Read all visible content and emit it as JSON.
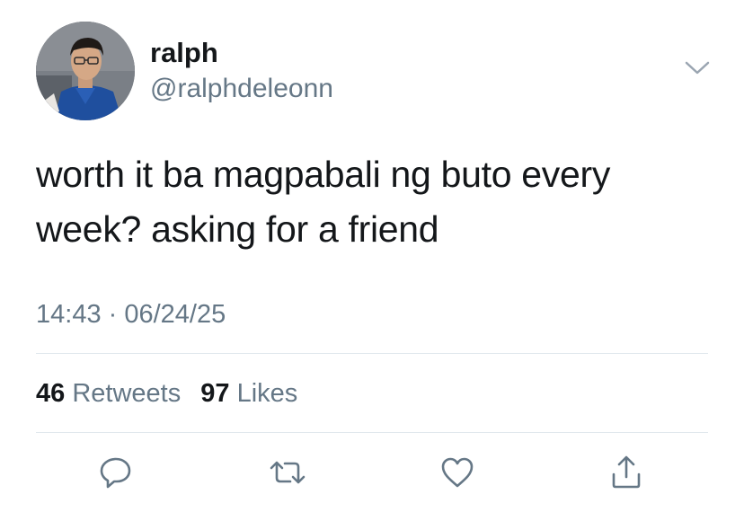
{
  "tweet": {
    "display_name": "ralph",
    "handle": "@ralphdeleonn",
    "text": "worth it ba magpabali ng buto every week? asking for a friend",
    "timestamp": "14:43 · 06/24/25"
  },
  "stats": {
    "retweets_count": "46",
    "retweets_label": "Retweets",
    "likes_count": "97",
    "likes_label": "Likes"
  },
  "icons": {
    "menu": "chevron-down-icon",
    "reply": "reply-icon",
    "retweet": "retweet-icon",
    "like": "heart-icon",
    "share": "share-icon"
  },
  "colors": {
    "text_primary": "#14171a",
    "text_secondary": "#657786",
    "icon_gray": "#657786",
    "divider": "#e1e8ed"
  }
}
